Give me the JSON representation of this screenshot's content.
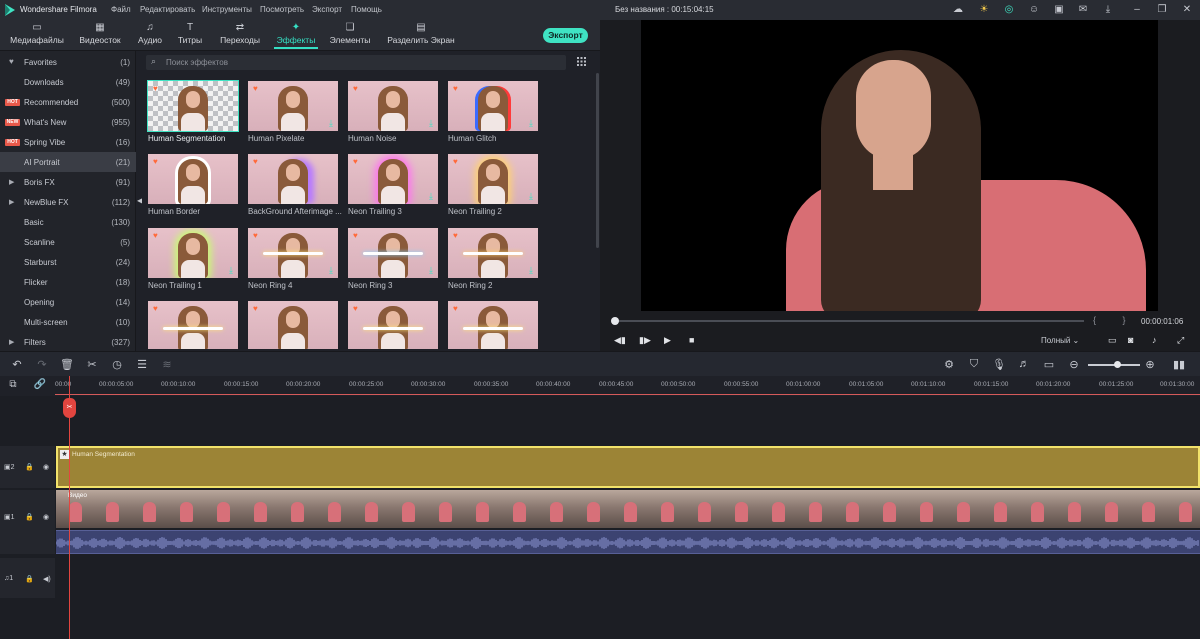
{
  "titlebar": {
    "app_title": "Wondershare Filmora",
    "menu": [
      "Файл",
      "Редактировать",
      "Инструменты",
      "Посмотреть",
      "Экспорт",
      "Помощь"
    ],
    "project_title": "Без названия : 00:15:04:15",
    "icons": [
      "cloud-icon",
      "bulb-icon",
      "headset-icon",
      "account-icon",
      "save-icon",
      "mail-icon",
      "download-icon",
      "minimize-icon",
      "restore-icon",
      "close-icon"
    ]
  },
  "toolbar": {
    "tabs": [
      {
        "label": "Медиафайлы",
        "icon": "folder-icon"
      },
      {
        "label": "Видеосток",
        "icon": "stock-icon"
      },
      {
        "label": "Аудио",
        "icon": "music-icon"
      },
      {
        "label": "Титры",
        "icon": "title-icon"
      },
      {
        "label": "Переходы",
        "icon": "transition-icon"
      },
      {
        "label": "Эффекты",
        "icon": "effects-icon",
        "active": true
      },
      {
        "label": "Элементы",
        "icon": "elements-icon"
      },
      {
        "label": "Разделить Экран",
        "icon": "split-screen-icon"
      }
    ],
    "export_label": "Экспорт"
  },
  "sidebar": {
    "items": [
      {
        "name": "Favorites",
        "count": "(1)",
        "icon": "heart-icon"
      },
      {
        "name": "Downloads",
        "count": "(49)"
      },
      {
        "name": "Recommended",
        "count": "(500)",
        "badge": "HOT"
      },
      {
        "name": "What's New",
        "count": "(955)",
        "badge": "NEW"
      },
      {
        "name": "Spring Vibe",
        "count": "(16)",
        "badge": "HOT"
      },
      {
        "name": "AI Portrait",
        "count": "(21)",
        "active": true
      },
      {
        "name": "Boris FX",
        "count": "(91)",
        "expandable": true
      },
      {
        "name": "NewBlue FX",
        "count": "(112)",
        "expandable": true
      },
      {
        "name": "Basic",
        "count": "(130)"
      },
      {
        "name": "Scanline",
        "count": "(5)"
      },
      {
        "name": "Starburst",
        "count": "(24)"
      },
      {
        "name": "Flicker",
        "count": "(18)"
      },
      {
        "name": "Opening",
        "count": "(14)"
      },
      {
        "name": "Multi-screen",
        "count": "(10)"
      },
      {
        "name": "Filters",
        "count": "(327)",
        "expandable": true
      }
    ]
  },
  "effects": {
    "search_placeholder": "Поиск эффектов",
    "cards": [
      {
        "name": "Human Segmentation",
        "selected": true
      },
      {
        "name": "Human Pixelate"
      },
      {
        "name": "Human Noise"
      },
      {
        "name": "Human Glitch"
      },
      {
        "name": "Human Border"
      },
      {
        "name": "BackGround Afterimage ..."
      },
      {
        "name": "Neon Trailing 3"
      },
      {
        "name": "Neon Trailing 2"
      },
      {
        "name": "Neon Trailing 1"
      },
      {
        "name": "Neon Ring 4"
      },
      {
        "name": "Neon Ring 3"
      },
      {
        "name": "Neon Ring 2"
      },
      {
        "name": ""
      },
      {
        "name": ""
      },
      {
        "name": ""
      },
      {
        "name": ""
      }
    ]
  },
  "preview": {
    "timecode": "00:00:01:06",
    "quality": "Полный",
    "progress": 0.0
  },
  "timeline": {
    "ticks": [
      "00:00",
      "00:00:05:00",
      "00:00:10:00",
      "00:00:15:00",
      "00:00:20:00",
      "00:00:25:00",
      "00:00:30:00",
      "00:00:35:00",
      "00:00:40:00",
      "00:00:45:00",
      "00:00:50:00",
      "00:00:55:00",
      "00:01:00:00",
      "00:01:05:00",
      "00:01:10:00",
      "00:01:15:00",
      "00:01:20:00",
      "00:01:25:00",
      "00:01:30:00"
    ],
    "effect_clip_label": "Human Segmentation",
    "video_clip_label": "Видео",
    "track_labels": {
      "fx": "2",
      "video": "1",
      "audio": "1"
    }
  }
}
